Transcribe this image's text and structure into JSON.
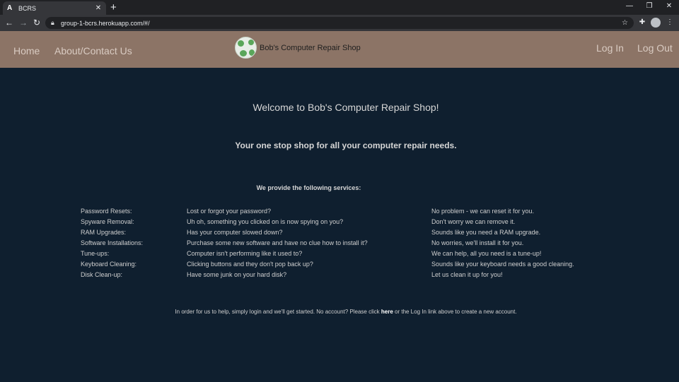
{
  "browser": {
    "tab_title": "BCRS",
    "tab_favicon": "A",
    "url": "group-1-bcrs.herokuapp.com/#/"
  },
  "nav": {
    "home": "Home",
    "about": "About/Contact Us",
    "login": "Log In",
    "logout": "Log Out"
  },
  "brand": {
    "name": "Bob's Computer Repair Shop",
    "logo_icon": "bcrs-logo"
  },
  "main": {
    "welcome": "Welcome to Bob's Computer Repair Shop!",
    "tagline": "Your one stop shop for all your computer repair needs.",
    "services_heading": "We provide the following services:",
    "services": [
      {
        "name": "Password Resets:",
        "problem": "Lost or forgot your password?",
        "solution": "No problem - we can reset it for you."
      },
      {
        "name": "Spyware Removal:",
        "problem": "Uh oh, something you clicked on is now spying on you?",
        "solution": "Don't worry we can remove it."
      },
      {
        "name": "RAM Upgrades:",
        "problem": "Has your computer slowed down?",
        "solution": "Sounds like you need a RAM upgrade."
      },
      {
        "name": "Software Installations:",
        "problem": "Purchase some new software and have no clue how to install it?",
        "solution": "No worries, we'll install it for you."
      },
      {
        "name": "Tune-ups:",
        "problem": "Computer isn't performing like it used to?",
        "solution": "We can help, all you need is a tune-up!"
      },
      {
        "name": "Keyboard Cleaning:",
        "problem": "Clicking buttons and they don't pop back up?",
        "solution": "Sounds like your keyboard needs a good cleaning."
      },
      {
        "name": "Disk Clean-up:",
        "problem": "Have some junk on your hard disk?",
        "solution": "Let us clean it up for you!"
      }
    ],
    "footer_before": "In order for us to help, simply login and we'll get started. No account? Please click ",
    "footer_link": "here",
    "footer_after": " or the Log In link above to create a new account."
  },
  "colors": {
    "header_bg": "#8c7466",
    "page_bg": "#0f1f2f"
  }
}
